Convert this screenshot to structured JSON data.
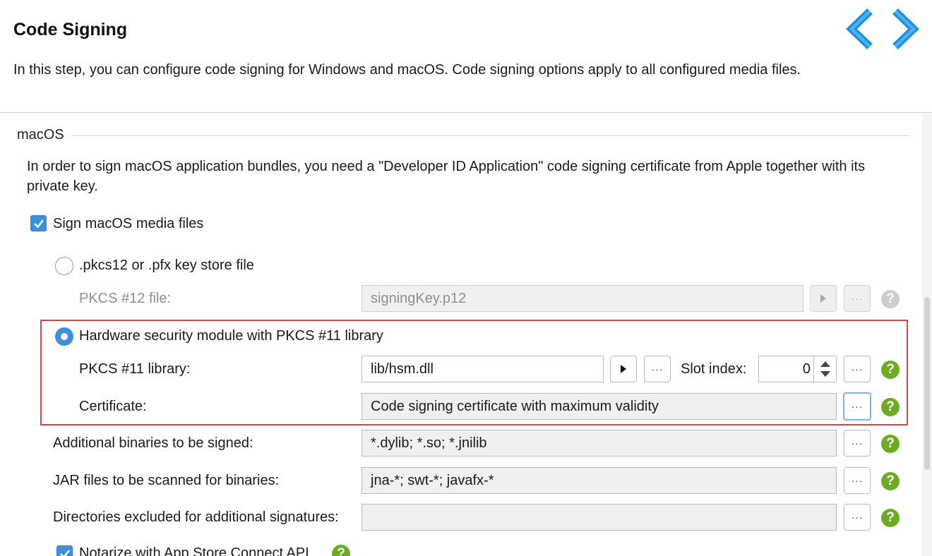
{
  "header": {
    "title": "Code Signing",
    "description": "In this step, you can configure code signing for Windows and macOS. Code signing options apply to all configured media files."
  },
  "section": {
    "title": "macOS",
    "description": "In order to sign macOS application bundles, you need a \"Developer ID Application\" code signing certificate from Apple together with its private key."
  },
  "sign_checkbox": {
    "label": "Sign macOS media files",
    "checked": true
  },
  "pkcs12_option": {
    "label": ".pkcs12 or .pfx key store file",
    "selected": false,
    "file_label": "PKCS #12 file:",
    "file_value": "signingKey.p12"
  },
  "hsm_option": {
    "label": "Hardware security module with PKCS #11 library",
    "selected": true,
    "library_label": "PKCS #11 library:",
    "library_value": "lib/hsm.dll",
    "slot_label": "Slot index:",
    "slot_value": "0",
    "certificate_label": "Certificate:",
    "certificate_value": "Code signing certificate with maximum validity"
  },
  "additional_binaries": {
    "label": "Additional binaries to be signed:",
    "value": "*.dylib; *.so; *.jnilib"
  },
  "jar_files": {
    "label": "JAR files to be scanned for binaries:",
    "value": "jna-*; swt-*; javafx-*"
  },
  "excluded_dirs": {
    "label": "Directories excluded for additional signatures:",
    "value": ""
  },
  "notarize": {
    "label": "Notarize with App Store Connect API",
    "checked": true
  },
  "buttons": {
    "browse": "···",
    "help": "?"
  },
  "colors": {
    "accent": "#3d8fe0",
    "help": "#6dab23",
    "highlight": "#d9464a",
    "nav": "#1e90e0"
  },
  "icons": {
    "nav_back": "chevron-left-icon",
    "nav_forward": "chevron-right-icon",
    "run": "play-icon",
    "help": "question-icon"
  }
}
